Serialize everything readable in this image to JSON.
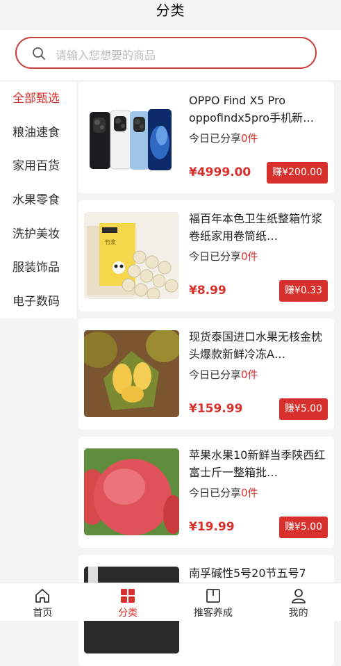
{
  "header": {
    "title": "分类"
  },
  "search": {
    "placeholder": "请输入您想要的商品"
  },
  "sidebar": {
    "items": [
      {
        "label": "全部甄选",
        "active": true
      },
      {
        "label": "粮油速食"
      },
      {
        "label": "家用百货"
      },
      {
        "label": "水果零食"
      },
      {
        "label": "洗护美妆"
      },
      {
        "label": "服装饰品"
      },
      {
        "label": "电子数码"
      }
    ]
  },
  "products": [
    {
      "name": "OPPO Find X5 Pro oppofindx5pro手机新…",
      "share_label": "今日已分享",
      "share_count": "0件",
      "price": "¥4999.00",
      "earn": "赚¥200.00",
      "image": "phone"
    },
    {
      "name": "福百年本色卫生纸整箱竹浆卷纸家用卷筒纸…",
      "share_label": "今日已分享",
      "share_count": "0件",
      "price": "¥8.99",
      "earn": "赚¥0.33",
      "image": "tissue"
    },
    {
      "name": "现货泰国进口水果无核金枕头爆款新鲜冷冻A…",
      "share_label": "今日已分享",
      "share_count": "0件",
      "price": "¥159.99",
      "earn": "赚¥5.00",
      "image": "durian"
    },
    {
      "name": "苹果水果10新鲜当季陕西红富士斤一整箱批…",
      "share_label": "今日已分享",
      "share_count": "0件",
      "price": "¥19.99",
      "earn": "赚¥5.00",
      "image": "apple"
    },
    {
      "name": "南孚碱性5号20节五号7",
      "share_label": "",
      "share_count": "",
      "price": "",
      "earn": "",
      "image": "battery"
    }
  ],
  "tabbar": {
    "items": [
      {
        "label": "首页",
        "icon": "home-icon"
      },
      {
        "label": "分类",
        "icon": "category-icon",
        "active": true
      },
      {
        "label": "推客养成",
        "icon": "book-icon"
      },
      {
        "label": "我的",
        "icon": "user-icon"
      }
    ]
  },
  "colors": {
    "accent": "#d8302c",
    "background": "#f4f4f4"
  }
}
